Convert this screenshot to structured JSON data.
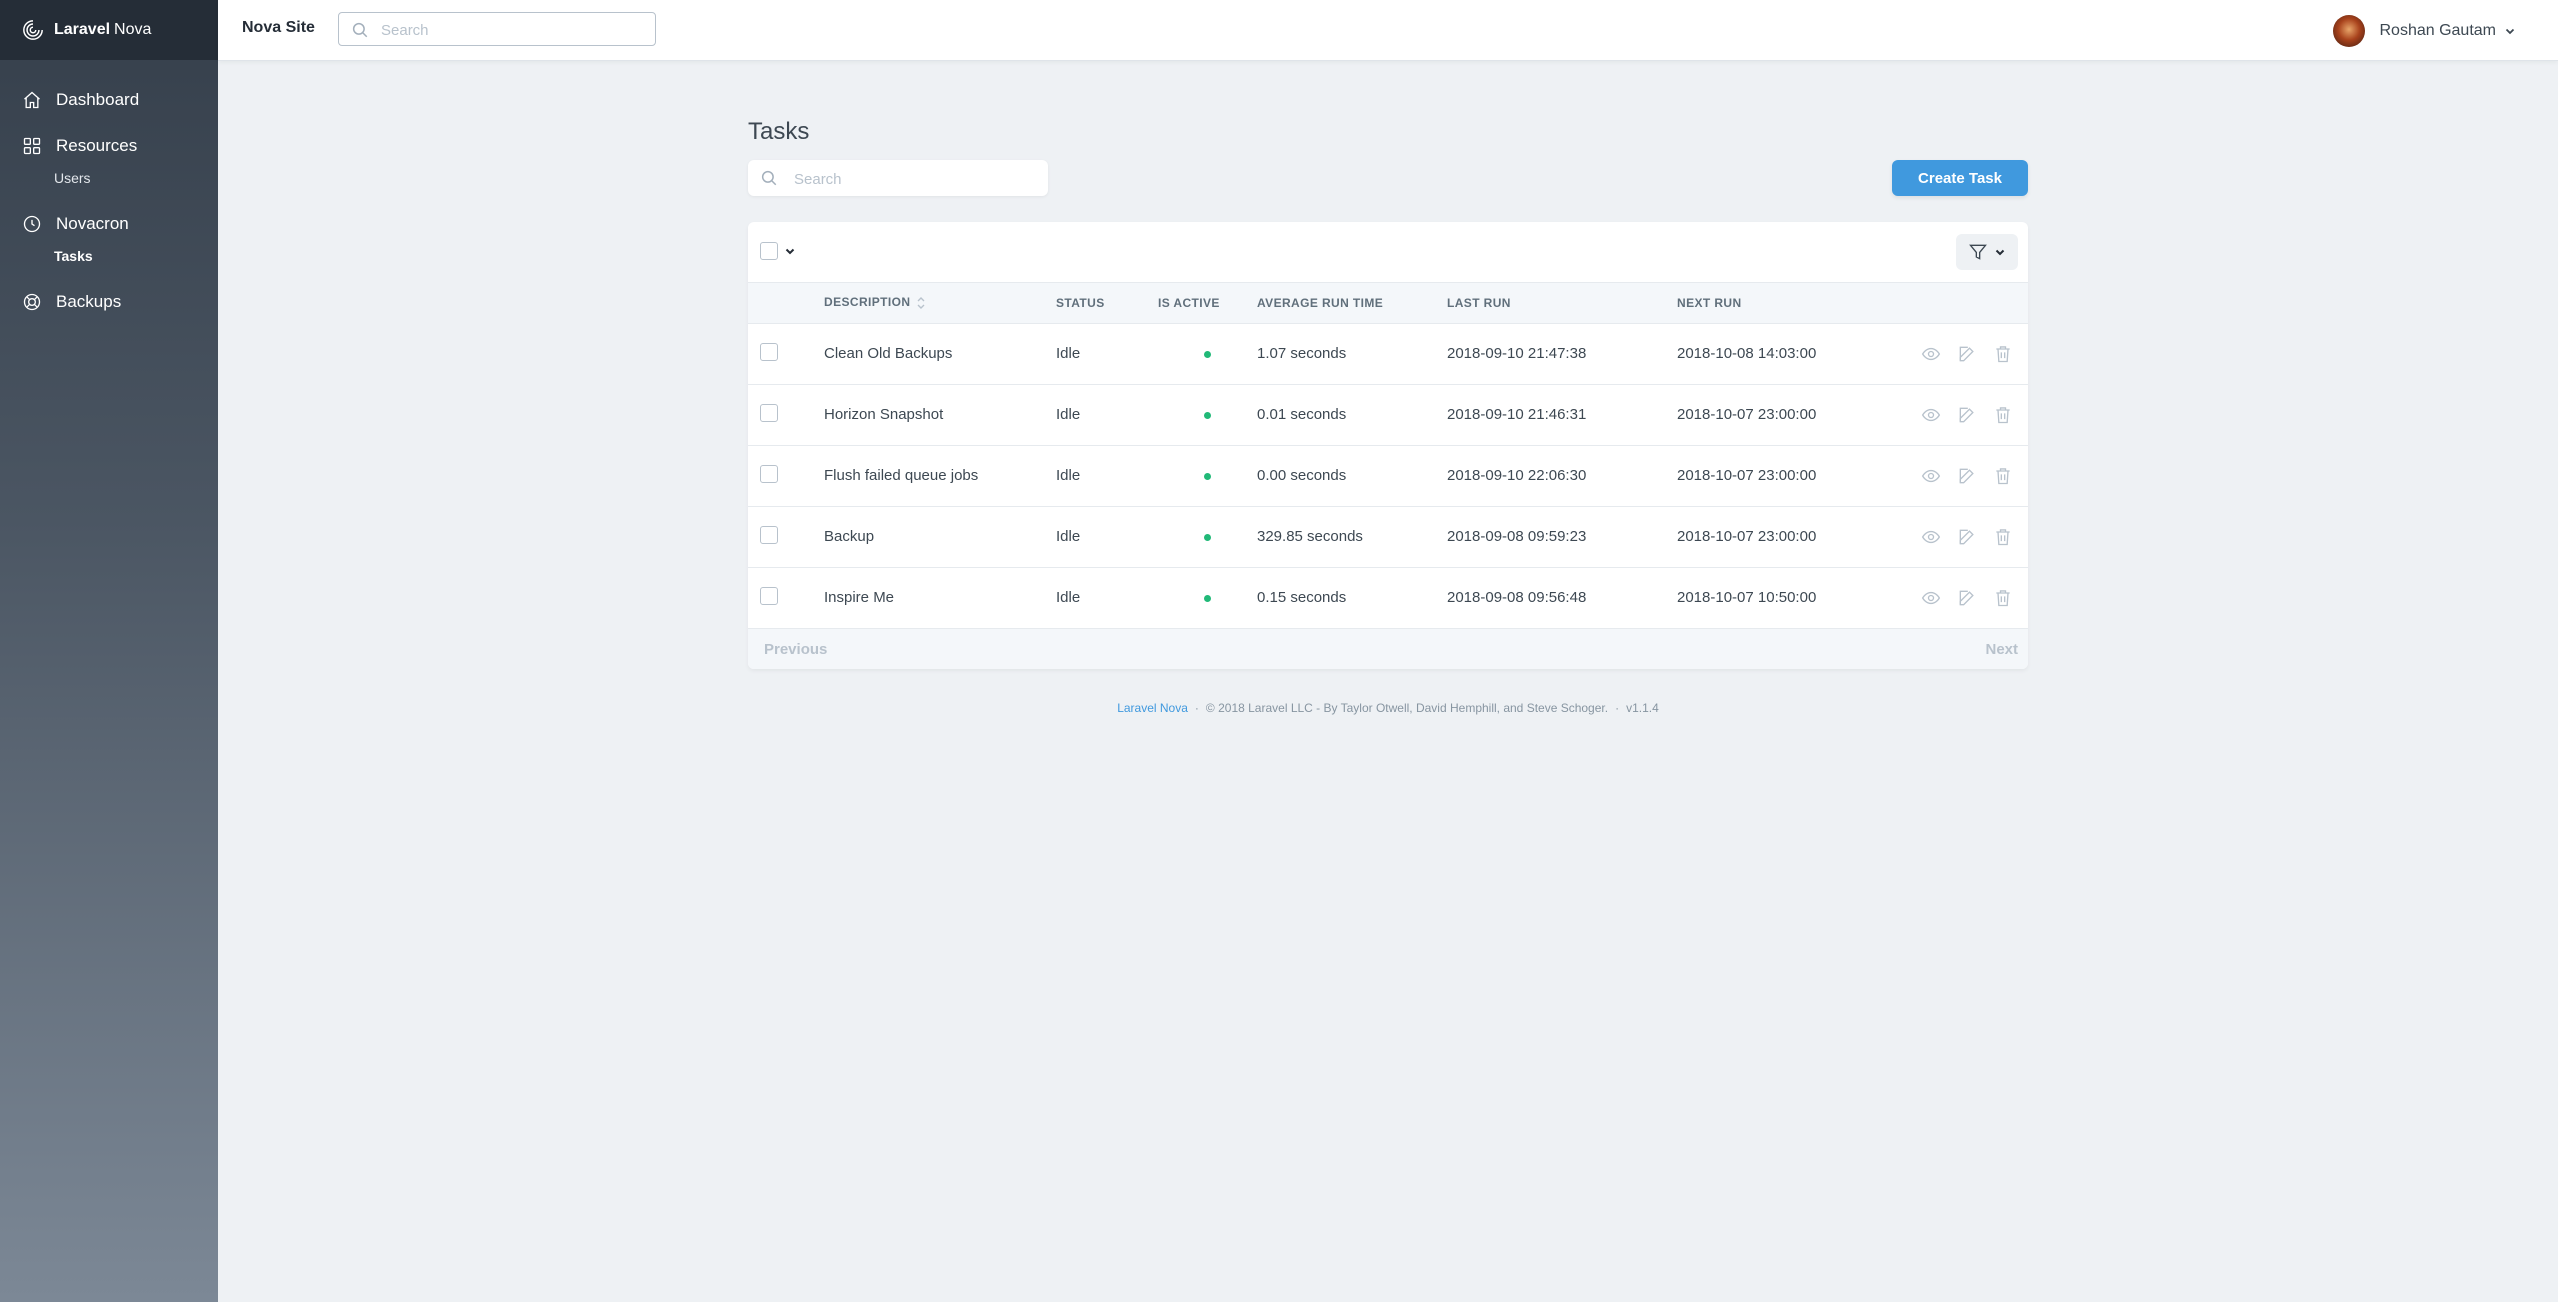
{
  "brand": {
    "bold": "Laravel",
    "light": "Nova"
  },
  "sidebar": {
    "items": [
      {
        "label": "Dashboard",
        "icon": "home-icon"
      },
      {
        "label": "Resources",
        "icon": "grid-icon",
        "children": [
          {
            "label": "Users"
          }
        ]
      },
      {
        "label": "Novacron",
        "icon": "clock-icon",
        "children": [
          {
            "label": "Tasks",
            "active": true
          }
        ]
      },
      {
        "label": "Backups",
        "icon": "lifebuoy-icon"
      }
    ]
  },
  "header": {
    "site_title": "Nova Site",
    "search_placeholder": "Search",
    "user_name": "Roshan Gautam"
  },
  "main": {
    "title": "Tasks",
    "search_placeholder": "Search",
    "create_label": "Create Task",
    "columns": [
      "Description",
      "Status",
      "Is Active",
      "Average Run Time",
      "Last Run",
      "Next Run"
    ],
    "rows": [
      {
        "description": "Clean Old Backups",
        "status": "Idle",
        "active": true,
        "avg": "1.07 seconds",
        "last": "2018-09-10 21:47:38",
        "next": "2018-10-08 14:03:00"
      },
      {
        "description": "Horizon Snapshot",
        "status": "Idle",
        "active": true,
        "avg": "0.01 seconds",
        "last": "2018-09-10 21:46:31",
        "next": "2018-10-07 23:00:00"
      },
      {
        "description": "Flush failed queue jobs",
        "status": "Idle",
        "active": true,
        "avg": "0.00 seconds",
        "last": "2018-09-10 22:06:30",
        "next": "2018-10-07 23:00:00"
      },
      {
        "description": "Backup",
        "status": "Idle",
        "active": true,
        "avg": "329.85 seconds",
        "last": "2018-09-08 09:59:23",
        "next": "2018-10-07 23:00:00"
      },
      {
        "description": "Inspire Me",
        "status": "Idle",
        "active": true,
        "avg": "0.15 seconds",
        "last": "2018-09-08 09:56:48",
        "next": "2018-10-07 10:50:00"
      }
    ],
    "pagination": {
      "previous": "Previous",
      "next": "Next"
    }
  },
  "footer": {
    "link": "Laravel Nova",
    "copyright": "© 2018 Laravel LLC - By Taylor Otwell, David Hemphill, and Steve Schoger.",
    "version": "v1.1.4"
  },
  "colors": {
    "accent": "#4099de",
    "active_dot": "#21b978",
    "sidebar_top": "#252d37"
  }
}
